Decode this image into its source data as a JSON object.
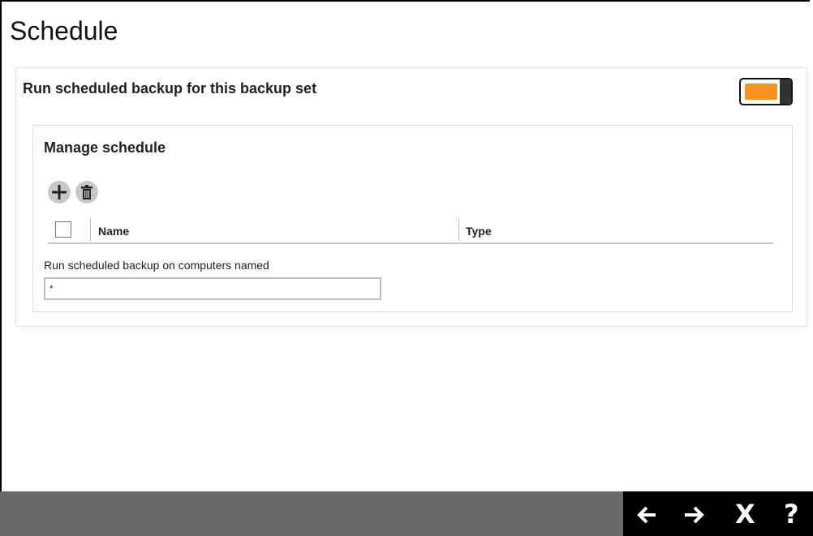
{
  "page": {
    "title": "Schedule"
  },
  "run_scheduled": {
    "label": "Run scheduled backup for this backup set",
    "enabled": true,
    "toggle_color": "#f7941d"
  },
  "manage_schedule": {
    "title": "Manage schedule",
    "add_icon": "plus-icon",
    "delete_icon": "trash-icon",
    "table": {
      "columns": [
        {
          "label": "Name"
        },
        {
          "label": "Type"
        }
      ],
      "rows": []
    },
    "computers_label": "Run scheduled backup on computers named",
    "computers_value": "*"
  },
  "footer": {
    "back_icon": "arrow-left-icon",
    "next_icon": "arrow-right-icon",
    "close_label": "X",
    "help_label": "?"
  }
}
